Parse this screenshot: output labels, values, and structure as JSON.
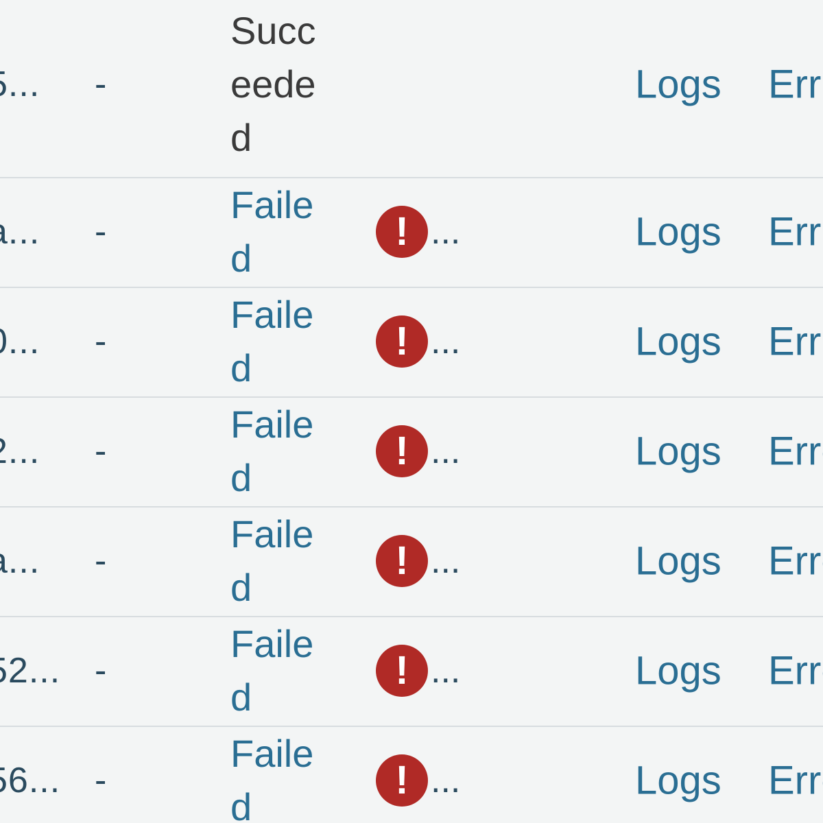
{
  "runs": [
    {
      "id": "5...",
      "dash": "-",
      "status": "Succeeded",
      "status_type": "ok",
      "has_error": false,
      "logs": "Logs",
      "errors": "Err"
    },
    {
      "id": "a...",
      "dash": "-",
      "status": "Failed",
      "status_type": "fail",
      "has_error": true,
      "ellipsis": "...",
      "logs": "Logs",
      "errors": "Err"
    },
    {
      "id": "0...",
      "dash": "-",
      "status": "Failed",
      "status_type": "fail",
      "has_error": true,
      "ellipsis": "...",
      "logs": "Logs",
      "errors": "Err"
    },
    {
      "id": "2...",
      "dash": "-",
      "status": "Failed",
      "status_type": "fail",
      "has_error": true,
      "ellipsis": "...",
      "logs": "Logs",
      "errors": "Erro"
    },
    {
      "id": "a...",
      "dash": "-",
      "status": "Failed",
      "status_type": "fail",
      "has_error": true,
      "ellipsis": "...",
      "logs": "Logs",
      "errors": "Erro"
    },
    {
      "id": "52...",
      "dash": "-",
      "status": "Failed",
      "status_type": "fail",
      "has_error": true,
      "ellipsis": "...",
      "logs": "Logs",
      "errors": "Erro"
    },
    {
      "id": "56...",
      "dash": "-",
      "status": "Failed",
      "status_type": "fail",
      "has_error": true,
      "ellipsis": "...",
      "logs": "Logs",
      "errors": "Erro"
    }
  ],
  "icons": {
    "error": "error-exclamation-icon",
    "error_glyph": "!"
  },
  "colors": {
    "link": "#2a6e93",
    "text": "#2a4a5e",
    "error": "#b02a26",
    "background": "#f3f5f5"
  }
}
